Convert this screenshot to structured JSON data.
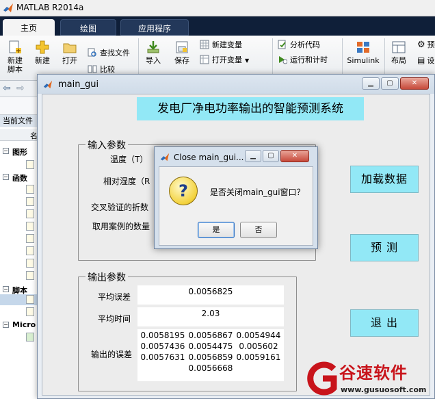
{
  "app": {
    "title": "MATLAB R2014a"
  },
  "ribbon": {
    "tabs": [
      {
        "label": "主页"
      },
      {
        "label": "绘图"
      },
      {
        "label": "应用程序"
      }
    ],
    "buttons": {
      "new_script": "新建\n脚本",
      "new": "新建",
      "open": "打开",
      "find_files": "查找文件",
      "compare": "比较",
      "import": "导入",
      "save": "保存",
      "new_variable": "新建变量",
      "open_variable": "打开变量",
      "analyze_code": "分析代码",
      "run_and_time": "运行和计时",
      "simulink": "Simulink",
      "layout": "布局",
      "preferences": "预",
      "settings": "设"
    }
  },
  "left_panel": {
    "current_folder": "当前文件",
    "name_col": "名",
    "sections": [
      {
        "label": "图形"
      },
      {
        "label": "函数"
      },
      {
        "label": "脚本"
      },
      {
        "label": "Micro"
      }
    ]
  },
  "gui": {
    "window_title": "main_gui",
    "heading": "发电厂净电功率输出的智能预测系统",
    "input_panel": {
      "title": "输入参数",
      "labels": {
        "temperature": "温度（T）",
        "humidity": "相对湿度（R",
        "folds": "交叉验证的折数",
        "cases": "取用案例的数量"
      }
    },
    "output_panel": {
      "title": "输出参数",
      "mean_error_label": "平均误差",
      "mean_error_value": "0.0056825",
      "mean_time_label": "平均时间",
      "mean_time_value": "2.03",
      "errors_label": "输出的误差",
      "errors": [
        [
          "0.0058195",
          "0.0056867",
          "0.0054944"
        ],
        [
          "0.0057436",
          "0.0054475",
          "0.005602"
        ],
        [
          "0.0057631",
          "0.0056859",
          "0.0059161"
        ]
      ],
      "errors_last": "0.0056668"
    },
    "buttons": {
      "load": "加载数据",
      "predict": "预 测",
      "exit": "退 出"
    }
  },
  "dialog": {
    "title": "Close main_gui...",
    "message": "是否关闭main_gui窗口？",
    "yes": "是",
    "no": "否"
  },
  "watermark": {
    "name": "谷速软件",
    "url": "www.gusuosoft.com"
  },
  "colors": {
    "accent_cyan": "#92e8f6",
    "ribbon_dark": "#0f1f39",
    "watermark_red": "#c8141b"
  }
}
